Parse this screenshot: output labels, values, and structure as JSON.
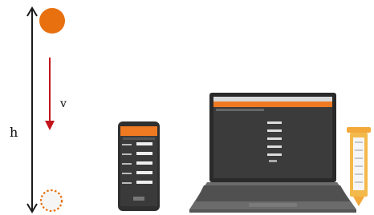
{
  "labels": {
    "height": "h",
    "velocity": "v"
  },
  "colors": {
    "ball": "#e8700f",
    "arrow": "#c4141b",
    "axis": "#1b1b1b",
    "phone_body": "#2f2f2f",
    "phone_header": "#f07a22",
    "laptop_body": "#6b6b6b",
    "laptop_screen": "#3b3b3b",
    "sensor_tube": "#f3b94a"
  },
  "icons": {
    "ball": "ball-icon",
    "ball_ghost": "ball-ghost-icon",
    "phone": "phone-icon",
    "laptop": "laptop-icon",
    "sensor": "sensor-icon"
  }
}
